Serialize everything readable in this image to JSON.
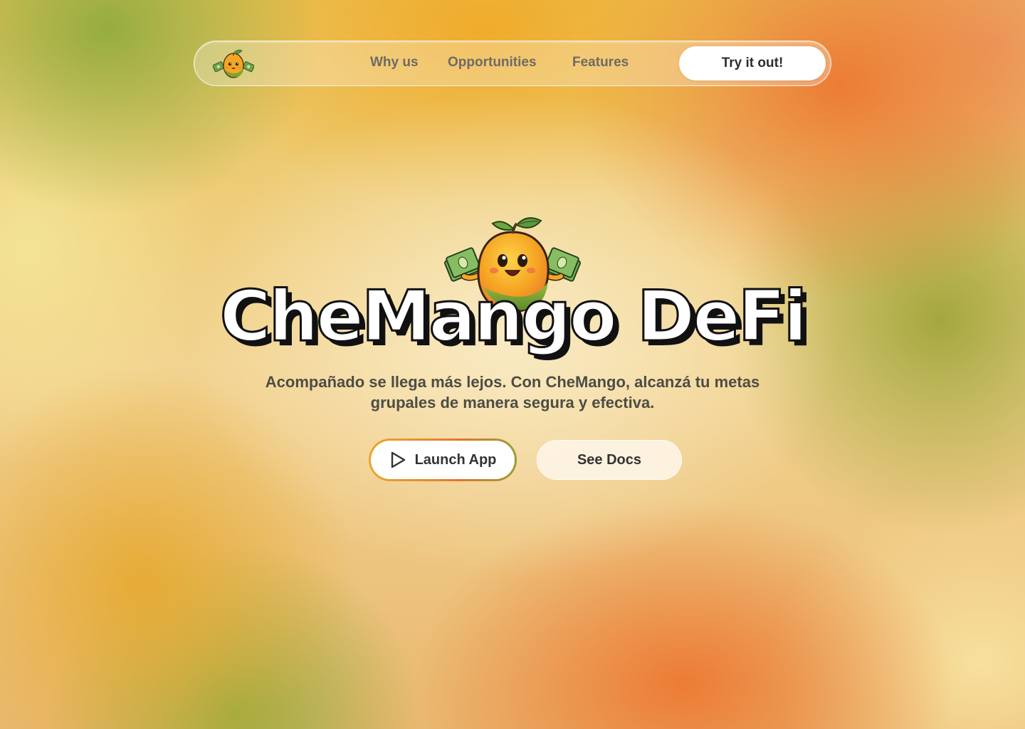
{
  "nav": {
    "logo_icon": "mango-mascot-icon",
    "links": [
      {
        "label": "Why us"
      },
      {
        "label": "Opportunities"
      },
      {
        "label": "Features"
      }
    ],
    "cta_label": "Try it out!"
  },
  "hero": {
    "mascot_icon": "mango-mascot-icon",
    "title": "CheMango DeFi",
    "subtitle": "Acompañado se llega más lejos. Con CheMango, alcanzá tu metas grupales de manera segura y efectiva.",
    "primary_button": {
      "label": "Launch App",
      "icon": "play-icon"
    },
    "secondary_button": {
      "label": "See Docs"
    }
  },
  "colors": {
    "mango_orange": "#f39a2c",
    "mango_green": "#7fa334",
    "accent_gradient": [
      "#e9a630",
      "#e7722c",
      "#9a9e34"
    ],
    "text_dark": "#333333",
    "nav_text": "#6d6b64"
  }
}
